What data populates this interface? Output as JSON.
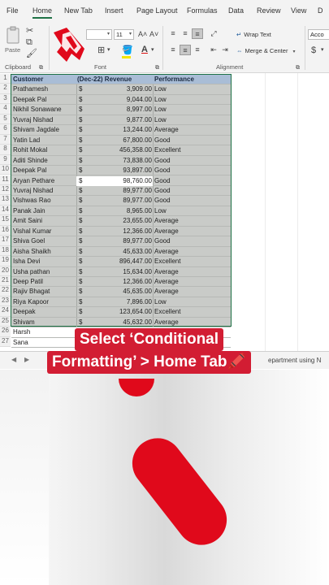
{
  "ribbon": {
    "tabs": [
      "File",
      "Home",
      "New Tab",
      "Insert",
      "Page Layout",
      "Formulas",
      "Data",
      "Review",
      "View",
      "D"
    ],
    "active_tab": "Home",
    "clipboard": {
      "paste_label": "Paste",
      "group_label": "Clipboard"
    },
    "font": {
      "font_size": "11",
      "grow_label": "A˄",
      "shrink_label": "A˅",
      "group_label": "Font"
    },
    "alignment": {
      "wrap_text_label": "Wrap Text",
      "merge_center_label": "Merge & Center",
      "group_label": "Alignment"
    },
    "number": {
      "format_value": "Acco",
      "currency_symbol": "$"
    }
  },
  "sheet": {
    "headers": {
      "customer": "Customer",
      "revenue": "(Dec-22) Revenue",
      "performance": "Performance"
    },
    "rows": [
      {
        "num": "2",
        "customer": "Prathamesh",
        "cur": "$",
        "revenue": "3,909.00",
        "performance": "Low"
      },
      {
        "num": "3",
        "customer": "Deepak Pal",
        "cur": "$",
        "revenue": "9,044.00",
        "performance": "Low"
      },
      {
        "num": "4",
        "customer": "Nikhil Sonawane",
        "cur": "$",
        "revenue": "8,997.00",
        "performance": "Low"
      },
      {
        "num": "5",
        "customer": "Yuvraj Nishad",
        "cur": "$",
        "revenue": "9,877.00",
        "performance": "Low"
      },
      {
        "num": "6",
        "customer": "Shivam Jagdale",
        "cur": "$",
        "revenue": "13,244.00",
        "performance": "Average"
      },
      {
        "num": "7",
        "customer": "Yatin Lad",
        "cur": "$",
        "revenue": "67,800.00",
        "performance": "Good"
      },
      {
        "num": "8",
        "customer": "Rohit Mokal",
        "cur": "$",
        "revenue": "456,358.00",
        "performance": "Excellent"
      },
      {
        "num": "9",
        "customer": "Aditi Shinde",
        "cur": "$",
        "revenue": "73,838.00",
        "performance": "Good"
      },
      {
        "num": "10",
        "customer": "Deepak Pal",
        "cur": "$",
        "revenue": "93,897.00",
        "performance": "Good"
      },
      {
        "num": "11",
        "customer": "Aryan Pethare",
        "cur": "$",
        "revenue": "98,760.00",
        "performance": "Good"
      },
      {
        "num": "12",
        "customer": "Yuvraj Nishad",
        "cur": "$",
        "revenue": "89,977.00",
        "performance": "Good"
      },
      {
        "num": "13",
        "customer": "Vishwas Rao",
        "cur": "$",
        "revenue": "89,977.00",
        "performance": "Good"
      },
      {
        "num": "14",
        "customer": "Panak Jain",
        "cur": "$",
        "revenue": "8,965.00",
        "performance": "Low"
      },
      {
        "num": "15",
        "customer": "Amit Saini",
        "cur": "$",
        "revenue": "23,655.00",
        "performance": "Average"
      },
      {
        "num": "16",
        "customer": "Vishal Kumar",
        "cur": "$",
        "revenue": "12,366.00",
        "performance": "Average"
      },
      {
        "num": "17",
        "customer": "Shiva Goel",
        "cur": "$",
        "revenue": "89,977.00",
        "performance": "Good"
      },
      {
        "num": "18",
        "customer": "Aisha Shaikh",
        "cur": "$",
        "revenue": "45,633.00",
        "performance": "Average"
      },
      {
        "num": "19",
        "customer": "Isha Devi",
        "cur": "$",
        "revenue": "896,447.00",
        "performance": "Excellent"
      },
      {
        "num": "20",
        "customer": "Usha pathan",
        "cur": "$",
        "revenue": "15,634.00",
        "performance": "Average"
      },
      {
        "num": "21",
        "customer": "Deep Patil",
        "cur": "$",
        "revenue": "12,366.00",
        "performance": "Average"
      },
      {
        "num": "22",
        "customer": "Rajiv Bhagat",
        "cur": "$",
        "revenue": "45,635.00",
        "performance": "Average"
      },
      {
        "num": "23",
        "customer": "Riya Kapoor",
        "cur": "$",
        "revenue": "7,896.00",
        "performance": "Low"
      },
      {
        "num": "24",
        "customer": "Deepak",
        "cur": "$",
        "revenue": "123,654.00",
        "performance": "Excellent"
      },
      {
        "num": "25",
        "customer": "Shivam",
        "cur": "$",
        "revenue": "45,632.00",
        "performance": "Average"
      },
      {
        "num": "26",
        "customer": "Harsh",
        "cur": "",
        "revenue": "",
        "performance": ""
      },
      {
        "num": "27",
        "customer": "Sana",
        "cur": "",
        "revenue": "",
        "performance": ""
      }
    ],
    "active_row": "11",
    "sheet_tab_label": "epartment using N"
  },
  "caption": {
    "line1": "Select ‘Conditional",
    "line2": "Formatting’ > Home Tab🖍️"
  },
  "colors": {
    "accent": "#1e7145",
    "header_fill": "#a9bdd6",
    "caption_bg": "#d21d33",
    "brand_red": "#e0091b"
  }
}
